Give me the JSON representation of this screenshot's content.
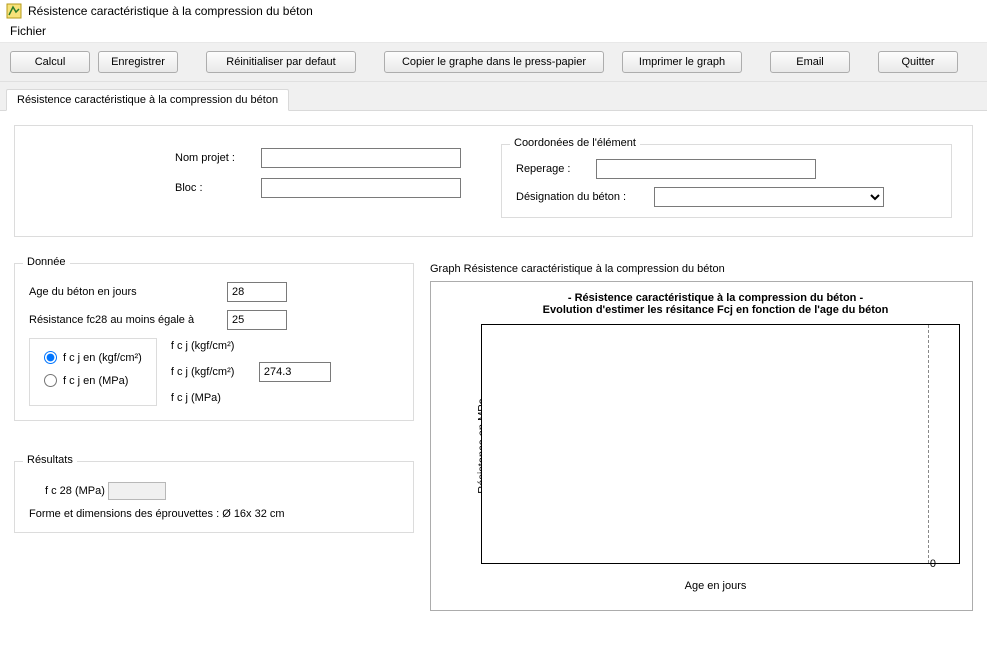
{
  "window": {
    "title": "Résistence caractéristique à la compression du béton"
  },
  "menubar": {
    "file": "Fichier"
  },
  "toolbar": {
    "calcul": "Calcul",
    "enregistrer": "Enregistrer",
    "reinit": "Réinitialiser par defaut",
    "copier": "Copier le graphe dans le press-papier",
    "imprimer": "Imprimer le graph",
    "email": "Email",
    "quitter": "Quitter"
  },
  "tab": {
    "label": "Résistence caractéristique à la compression du béton"
  },
  "project": {
    "nom_label": "Nom projet :",
    "nom_value": "",
    "bloc_label": "Bloc :",
    "bloc_value": ""
  },
  "coord": {
    "legend": "Coordonées de l'élément",
    "reperage_label": "Reperage :",
    "reperage_value": "",
    "designation_label": "Désignation du béton :",
    "designation_value": ""
  },
  "donnee": {
    "legend": "Donnée",
    "age_label": "Age du béton en jours",
    "age_value": "28",
    "fc28_label": "Résistance fc28 au moins égale à",
    "fc28_value": "25",
    "unit_header": "f c j  (kgf/cm²)",
    "radio_kgf": "f c j  en (kgf/cm²)",
    "radio_mpa": "f c j  en (MPa)",
    "val_kgf_label": "f c j  (kgf/cm²)",
    "val_kgf_value": "274.3",
    "val_mpa_label": "f c j (MPa)",
    "selected_unit": "kgf"
  },
  "resultats": {
    "legend": "Résultats",
    "fc28_label": "f c 28   (MPa)",
    "fc28_value": "",
    "eprouvettes": "Forme et dimensions des éprouvettes : Ø 16x 32 cm"
  },
  "graph": {
    "outer_title": "Graph Résistence caractéristique à la compression du béton",
    "title_line1": "- Résistence caractéristique à la compression du béton -",
    "title_line2": "Evolution d'estimer les résitance Fcj en fonction de l'age du béton",
    "xlabel": "Age en jours",
    "ylabel": "Résistance en MPa",
    "x_zero": "0"
  },
  "chart_data": {
    "type": "line",
    "title": "- Résistence caractéristique à la compression du béton - Evolution d'estimer les résitance Fcj en fonction de l'age du béton",
    "xlabel": "Age en jours",
    "ylabel": "Résistance en MPa",
    "x": [],
    "series": [],
    "x_ticks": [
      0
    ]
  }
}
